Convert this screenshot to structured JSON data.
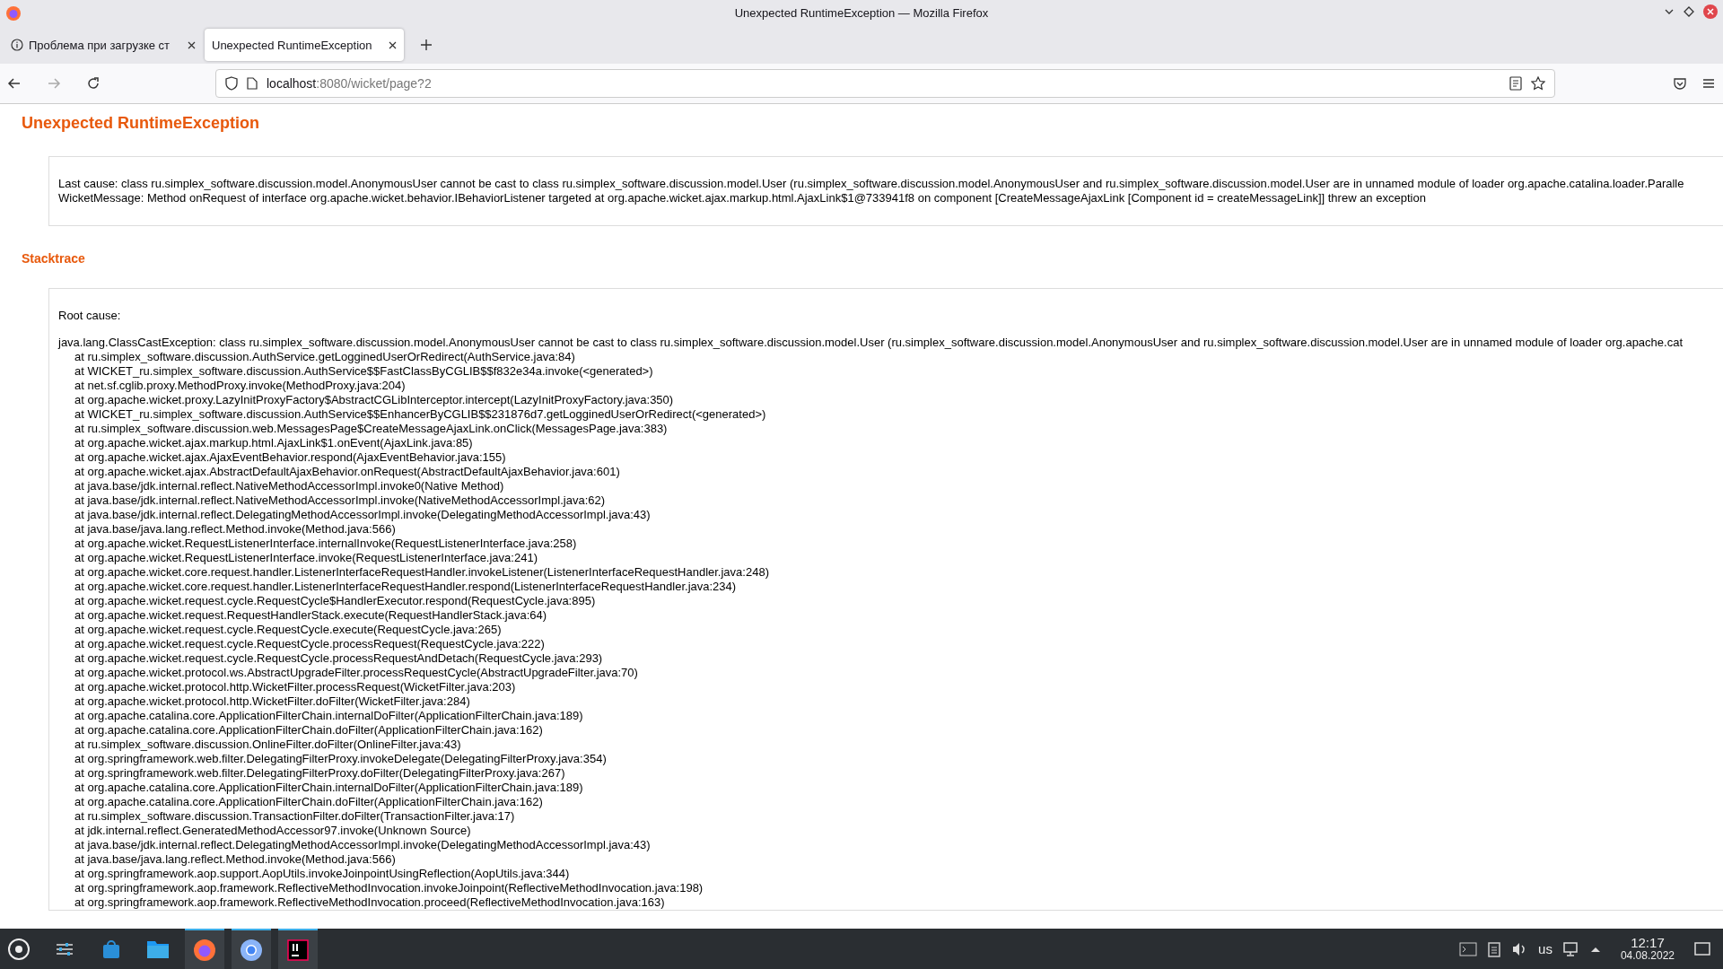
{
  "window": {
    "title": "Unexpected RuntimeException — Mozilla Firefox"
  },
  "tabs": [
    {
      "label": "Проблема при загрузке ст",
      "selected": false,
      "kind": "info"
    },
    {
      "label": "Unexpected RuntimeException",
      "selected": true,
      "kind": "plain"
    }
  ],
  "address_bar": {
    "host": "localhost",
    "rest": ":8080/wicket/page?2"
  },
  "page": {
    "heading": "Unexpected RuntimeException",
    "message_lines": [
      "Last cause: class ru.simplex_software.discussion.model.AnonymousUser cannot be cast to class ru.simplex_software.discussion.model.User (ru.simplex_software.discussion.model.AnonymousUser and ru.simplex_software.discussion.model.User are in unnamed module of loader org.apache.catalina.loader.Paralle",
      "WicketMessage: Method onRequest of interface org.apache.wicket.behavior.IBehaviorListener targeted at org.apache.wicket.ajax.markup.html.AjaxLink$1@733941f8 on component [CreateMessageAjaxLink [Component id = createMessageLink]] threw an exception"
    ],
    "stacktrace_heading": "Stacktrace",
    "root_cause_label": "Root cause:",
    "exception": "java.lang.ClassCastException: class ru.simplex_software.discussion.model.AnonymousUser cannot be cast to class ru.simplex_software.discussion.model.User (ru.simplex_software.discussion.model.AnonymousUser and ru.simplex_software.discussion.model.User are in unnamed module of loader org.apache.cat",
    "frames": [
      "at ru.simplex_software.discussion.AuthService.getLogginedUserOrRedirect(AuthService.java:84)",
      "at WICKET_ru.simplex_software.discussion.AuthService$$FastClassByCGLIB$$f832e34a.invoke(<generated>)",
      "at net.sf.cglib.proxy.MethodProxy.invoke(MethodProxy.java:204)",
      "at org.apache.wicket.proxy.LazyInitProxyFactory$AbstractCGLibInterceptor.intercept(LazyInitProxyFactory.java:350)",
      "at WICKET_ru.simplex_software.discussion.AuthService$$EnhancerByCGLIB$$231876d7.getLogginedUserOrRedirect(<generated>)",
      "at ru.simplex_software.discussion.web.MessagesPage$CreateMessageAjaxLink.onClick(MessagesPage.java:383)",
      "at org.apache.wicket.ajax.markup.html.AjaxLink$1.onEvent(AjaxLink.java:85)",
      "at org.apache.wicket.ajax.AjaxEventBehavior.respond(AjaxEventBehavior.java:155)",
      "at org.apache.wicket.ajax.AbstractDefaultAjaxBehavior.onRequest(AbstractDefaultAjaxBehavior.java:601)",
      "at java.base/jdk.internal.reflect.NativeMethodAccessorImpl.invoke0(Native Method)",
      "at java.base/jdk.internal.reflect.NativeMethodAccessorImpl.invoke(NativeMethodAccessorImpl.java:62)",
      "at java.base/jdk.internal.reflect.DelegatingMethodAccessorImpl.invoke(DelegatingMethodAccessorImpl.java:43)",
      "at java.base/java.lang.reflect.Method.invoke(Method.java:566)",
      "at org.apache.wicket.RequestListenerInterface.internalInvoke(RequestListenerInterface.java:258)",
      "at org.apache.wicket.RequestListenerInterface.invoke(RequestListenerInterface.java:241)",
      "at org.apache.wicket.core.request.handler.ListenerInterfaceRequestHandler.invokeListener(ListenerInterfaceRequestHandler.java:248)",
      "at org.apache.wicket.core.request.handler.ListenerInterfaceRequestHandler.respond(ListenerInterfaceRequestHandler.java:234)",
      "at org.apache.wicket.request.cycle.RequestCycle$HandlerExecutor.respond(RequestCycle.java:895)",
      "at org.apache.wicket.request.RequestHandlerStack.execute(RequestHandlerStack.java:64)",
      "at org.apache.wicket.request.cycle.RequestCycle.execute(RequestCycle.java:265)",
      "at org.apache.wicket.request.cycle.RequestCycle.processRequest(RequestCycle.java:222)",
      "at org.apache.wicket.request.cycle.RequestCycle.processRequestAndDetach(RequestCycle.java:293)",
      "at org.apache.wicket.protocol.ws.AbstractUpgradeFilter.processRequestCycle(AbstractUpgradeFilter.java:70)",
      "at org.apache.wicket.protocol.http.WicketFilter.processRequest(WicketFilter.java:203)",
      "at org.apache.wicket.protocol.http.WicketFilter.doFilter(WicketFilter.java:284)",
      "at org.apache.catalina.core.ApplicationFilterChain.internalDoFilter(ApplicationFilterChain.java:189)",
      "at org.apache.catalina.core.ApplicationFilterChain.doFilter(ApplicationFilterChain.java:162)",
      "at ru.simplex_software.discussion.OnlineFilter.doFilter(OnlineFilter.java:43)",
      "at org.springframework.web.filter.DelegatingFilterProxy.invokeDelegate(DelegatingFilterProxy.java:354)",
      "at org.springframework.web.filter.DelegatingFilterProxy.doFilter(DelegatingFilterProxy.java:267)",
      "at org.apache.catalina.core.ApplicationFilterChain.internalDoFilter(ApplicationFilterChain.java:189)",
      "at org.apache.catalina.core.ApplicationFilterChain.doFilter(ApplicationFilterChain.java:162)",
      "at ru.simplex_software.discussion.TransactionFilter.doFilter(TransactionFilter.java:17)",
      "at jdk.internal.reflect.GeneratedMethodAccessor97.invoke(Unknown Source)",
      "at java.base/jdk.internal.reflect.DelegatingMethodAccessorImpl.invoke(DelegatingMethodAccessorImpl.java:43)",
      "at java.base/java.lang.reflect.Method.invoke(Method.java:566)",
      "at org.springframework.aop.support.AopUtils.invokeJoinpointUsingReflection(AopUtils.java:344)",
      "at org.springframework.aop.framework.ReflectiveMethodInvocation.invokeJoinpoint(ReflectiveMethodInvocation.java:198)",
      "at org.springframework.aop.framework.ReflectiveMethodInvocation.proceed(ReflectiveMethodInvocation.java:163)"
    ]
  },
  "taskbar": {
    "apps": [
      {
        "kind": "mixer",
        "active": false
      },
      {
        "kind": "store",
        "active": false
      },
      {
        "kind": "files",
        "active": false
      },
      {
        "kind": "firefox",
        "active": true
      },
      {
        "kind": "chromium",
        "active": true
      },
      {
        "kind": "ide",
        "active": true
      }
    ],
    "keyboard_layout": "us",
    "time": "12:17",
    "date": "04.08.2022"
  }
}
